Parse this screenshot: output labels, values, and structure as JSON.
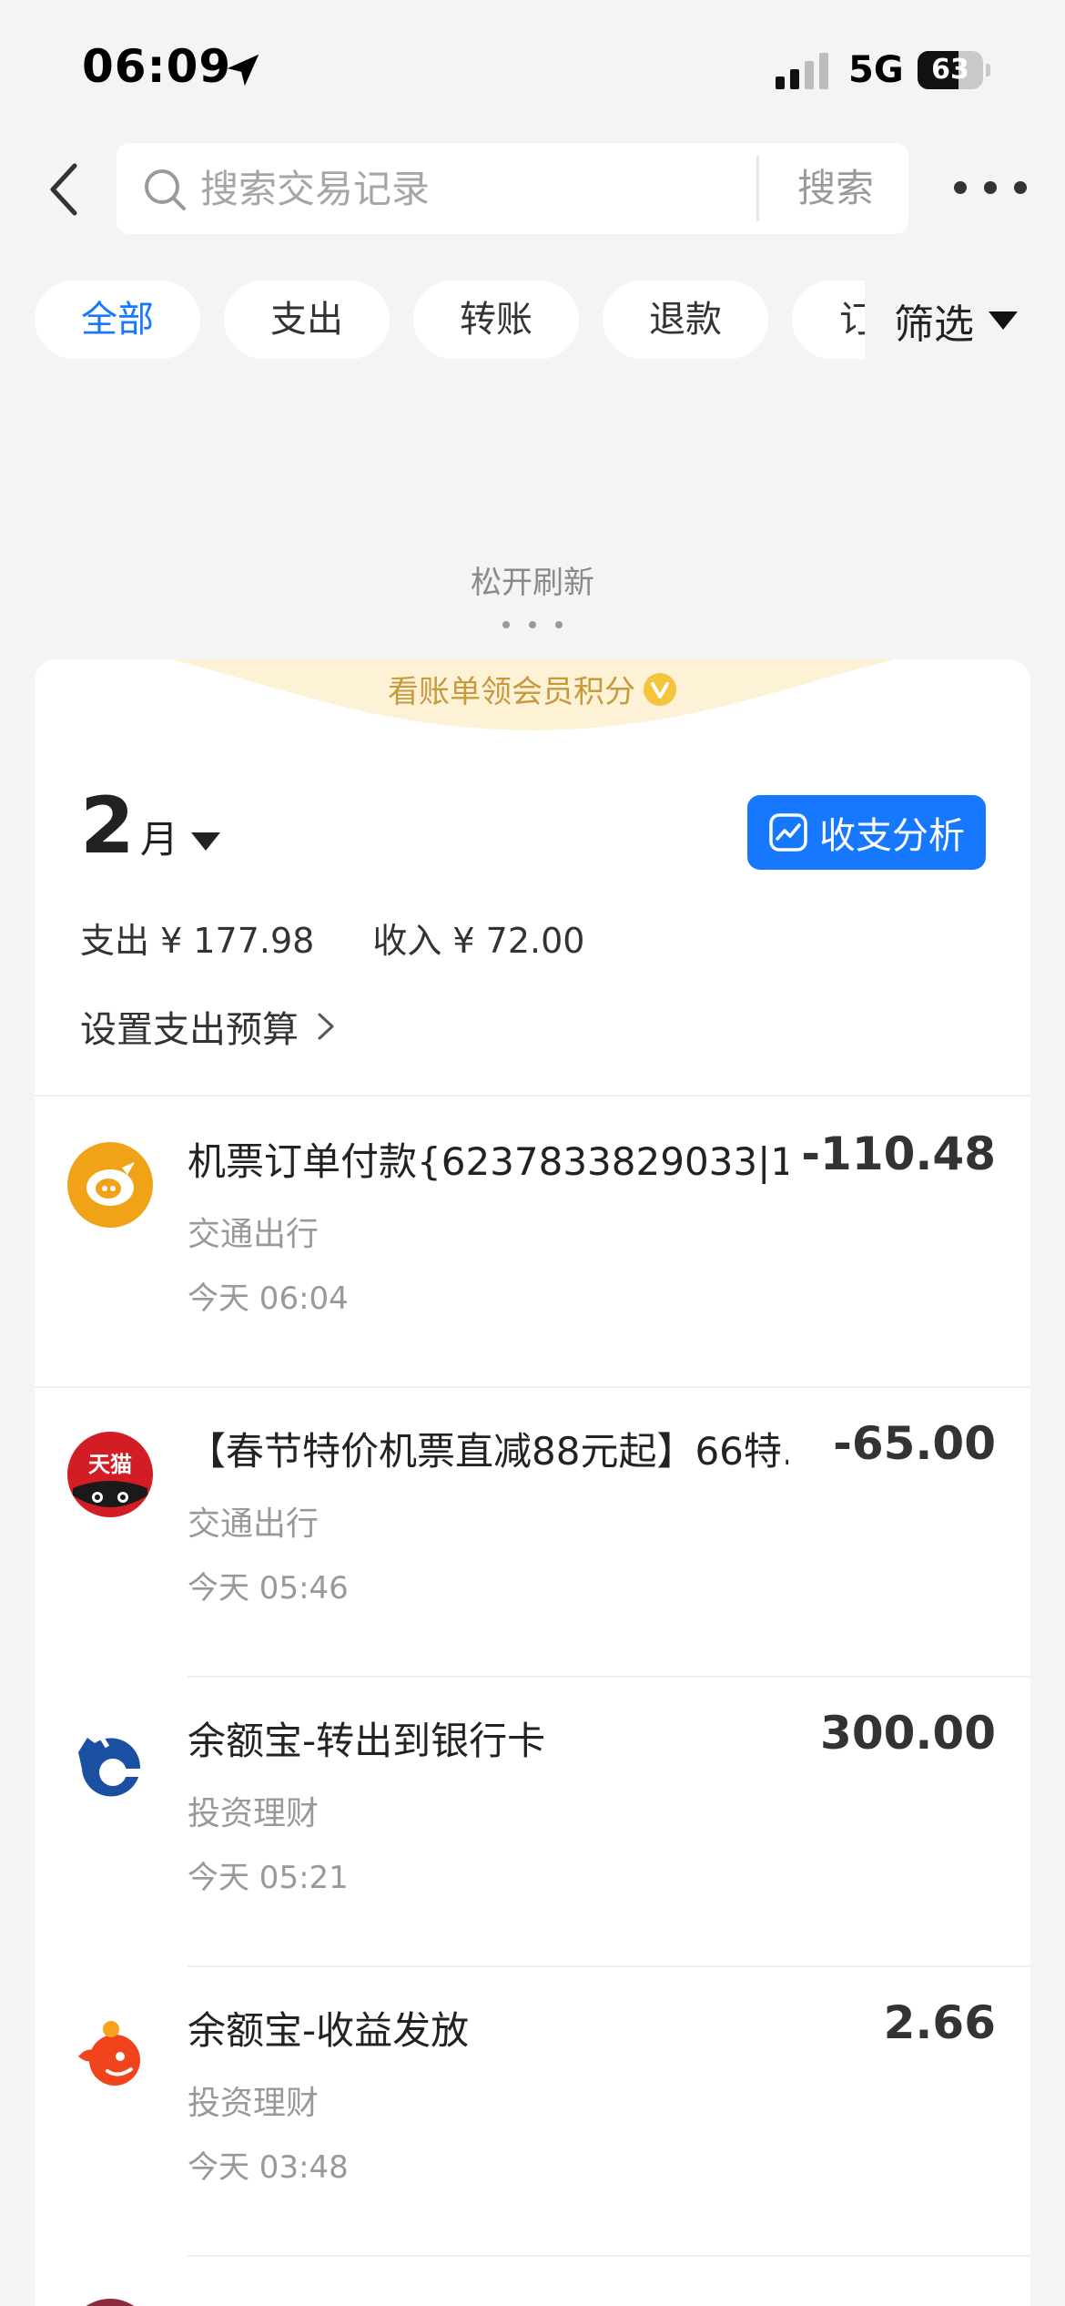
{
  "status_bar": {
    "time": "06:09",
    "network": "5G",
    "battery": "63",
    "battery_level": 0.63
  },
  "search": {
    "placeholder": "搜索交易记录",
    "button_label": "搜索"
  },
  "filters": {
    "chips": [
      {
        "label": "全部",
        "active": true
      },
      {
        "label": "支出",
        "active": false
      },
      {
        "label": "转账",
        "active": false
      },
      {
        "label": "退款",
        "active": false
      },
      {
        "label": "订",
        "active": false
      }
    ],
    "filter_label": "筛选"
  },
  "refresh_text": "松开刷新",
  "banner": {
    "text": "看账单领会员积分"
  },
  "month": {
    "number": "2",
    "unit": "月",
    "analysis_button": "收支分析",
    "expense": "支出 ¥ 177.98",
    "income": "收入 ¥ 72.00",
    "budget_link": "设置支出预算"
  },
  "transactions": [
    {
      "icon": "flight-ticket-icon",
      "title": "机票订单付款{6237833829033|1...",
      "amount": "-110.48",
      "category": "交通出行",
      "time": "今天 06:04",
      "icon_color": "#f0a317"
    },
    {
      "icon": "tmall-icon",
      "title": "【春节特价机票直减88元起】66特...",
      "amount": "-65.00",
      "category": "交通出行",
      "time": "今天 05:46",
      "icon_color": "#d31d24",
      "icon_text": "天猫"
    },
    {
      "icon": "bank-logo-icon",
      "title": "余额宝-转出到银行卡",
      "amount": "300.00",
      "category": "投资理财",
      "time": "今天 05:21",
      "icon_color": "#1b4fa2"
    },
    {
      "icon": "yuebao-income-icon",
      "title": "余额宝-收益发放",
      "amount": "2.66",
      "category": "投资理财",
      "time": "今天 03:48",
      "icon_color": "#f1441d"
    }
  ],
  "colors": {
    "accent": "#1677ff",
    "banner_text": "#c79a3e",
    "background": "#f4f4f4"
  }
}
